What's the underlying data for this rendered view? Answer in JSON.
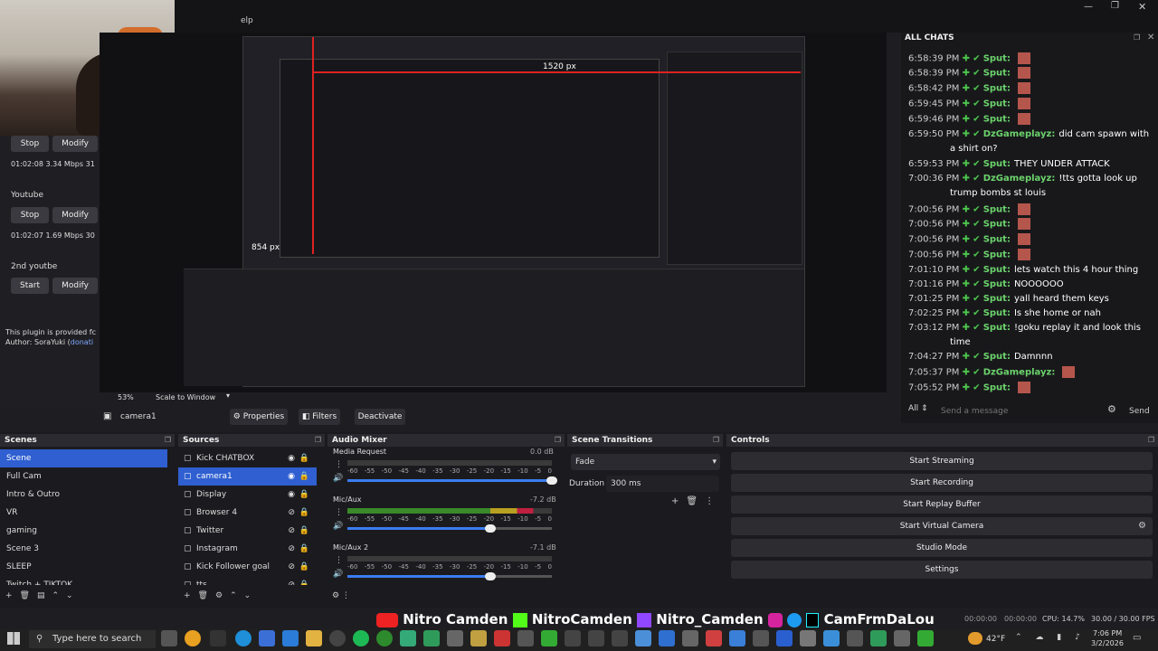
{
  "window": {
    "top_label": "elp"
  },
  "webcam": {
    "label": "webcam-feed"
  },
  "left_panel": {
    "streams": [
      {
        "name": "",
        "stop": "Stop",
        "modify": "Modify",
        "stats": "01:02:08  3.34 Mbps  31"
      },
      {
        "name": "Youtube",
        "stop": "Stop",
        "modify": "Modify",
        "stats": "01:02:07  1.69 Mbps  30"
      },
      {
        "name": "2nd youtbe",
        "start": "Start",
        "modify": "Modify"
      }
    ],
    "plugin_note": "This plugin is provided fc",
    "author": "Author: SoraYuki (",
    "author_link": "donati"
  },
  "preview": {
    "zoom": "53%",
    "scale": "Scale to Window",
    "px_h": "1520 px",
    "px_w": "854 px"
  },
  "source_bar": {
    "name": "camera1",
    "properties": "Properties",
    "filters": "Filters",
    "deactivate": "Deactivate"
  },
  "scenes": {
    "title": "Scenes",
    "items": [
      "Scene",
      "Full Cam",
      "Intro & Outro",
      "VR",
      "gaming",
      "Scene 3",
      "SLEEP",
      "Twitch + TIKTOK"
    ]
  },
  "sources": {
    "title": "Sources",
    "items": [
      "Kick CHATBOX",
      "camera1",
      "Display",
      "Browser 4",
      "Twitter",
      "Instagram",
      "Kick Follower goal",
      "tts"
    ]
  },
  "mixer": {
    "title": "Audio Mixer",
    "channels": [
      {
        "name": "Media Request",
        "db": "0.0 dB"
      },
      {
        "name": "Mic/Aux",
        "db": "-7.2 dB"
      },
      {
        "name": "Mic/Aux 2",
        "db": "-7.1 dB"
      }
    ],
    "ticks": [
      "-60",
      "-55",
      "-50",
      "-45",
      "-40",
      "-35",
      "-30",
      "-25",
      "-20",
      "-15",
      "-10",
      "-5",
      "0"
    ]
  },
  "transitions": {
    "title": "Scene Transitions",
    "selected": "Fade",
    "duration_label": "Duration",
    "duration": "300 ms"
  },
  "controls": {
    "title": "Controls",
    "buttons": [
      "Start Streaming",
      "Start Recording",
      "Start Replay Buffer",
      "Start Virtual Camera",
      "Studio Mode",
      "Settings"
    ]
  },
  "status": {
    "time1": "00:00:00",
    "time2": "00:00:00",
    "cpu": "CPU: 14.7%",
    "fps": "30.00 / 30.00 FPS"
  },
  "chat": {
    "title": "ALL CHATS",
    "filter": "All",
    "placeholder": "Send a message",
    "send": "Send",
    "messages": [
      {
        "time": "6:58:39 PM",
        "user": "Sput:",
        "text": ""
      },
      {
        "time": "6:58:39 PM",
        "user": "Sput:",
        "text": ""
      },
      {
        "time": "6:58:42 PM",
        "user": "Sput:",
        "text": ""
      },
      {
        "time": "6:59:45 PM",
        "user": "Sput:",
        "text": ""
      },
      {
        "time": "6:59:46 PM",
        "user": "Sput:",
        "text": ""
      },
      {
        "time": "6:59:50 PM",
        "user": "DzGameplayz:",
        "text": "did cam spawn with"
      },
      {
        "time": "",
        "user": "",
        "text": "a shirt on?"
      },
      {
        "time": "6:59:53 PM",
        "user": "Sput:",
        "text": "THEY UNDER ATTACK"
      },
      {
        "time": "7:00:36 PM",
        "user": "DzGameplayz:",
        "text": "!tts gotta look up"
      },
      {
        "time": "",
        "user": "",
        "text": "trump bombs st louis"
      },
      {
        "time": "7:00:56 PM",
        "user": "Sput:",
        "text": ""
      },
      {
        "time": "7:00:56 PM",
        "user": "Sput:",
        "text": ""
      },
      {
        "time": "7:00:56 PM",
        "user": "Sput:",
        "text": ""
      },
      {
        "time": "7:00:56 PM",
        "user": "Sput:",
        "text": ""
      },
      {
        "time": "7:01:10 PM",
        "user": "Sput:",
        "text": "lets watch this 4 hour thing"
      },
      {
        "time": "7:01:16 PM",
        "user": "Sput:",
        "text": "NOOOOOO"
      },
      {
        "time": "7:01:25 PM",
        "user": "Sput:",
        "text": "yall heard them keys"
      },
      {
        "time": "7:02:25 PM",
        "user": "Sput:",
        "text": "Is she home or nah"
      },
      {
        "time": "7:03:12 PM",
        "user": "Sput:",
        "text": "!goku replay it and look this"
      },
      {
        "time": "",
        "user": "",
        "text": "time"
      },
      {
        "time": "7:04:27 PM",
        "user": "Sput:",
        "text": "Damnnn"
      },
      {
        "time": "7:05:37 PM",
        "user": "DzGameplayz:",
        "text": ""
      },
      {
        "time": "7:05:52 PM",
        "user": "Sput:",
        "text": ""
      }
    ]
  },
  "overlay_banner": {
    "yt": "Nitro Camden",
    "kick": "NitroCamden",
    "twitch": "Nitro_Camden",
    "socials": "CamFrmDaLou"
  },
  "taskbar": {
    "search": "Type here to search",
    "temp": "42°F",
    "clock_time": "7:06 PM",
    "clock_date": "3/2/2026"
  }
}
